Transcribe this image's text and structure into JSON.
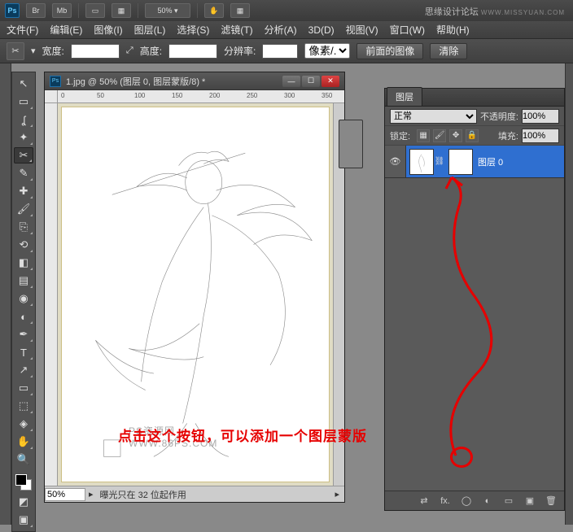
{
  "titlebar": {
    "zoom": "50% ▾"
  },
  "watermark_site": {
    "cn": "思缘设计论坛",
    "en": "WWW.MISSYUAN.COM"
  },
  "menu": {
    "file": "文件(F)",
    "edit": "编辑(E)",
    "image": "图像(I)",
    "layer": "图层(L)",
    "select": "选择(S)",
    "filter": "滤镜(T)",
    "analysis": "分析(A)",
    "three_d": "3D(D)",
    "view": "视图(V)",
    "window": "窗口(W)",
    "help": "帮助(H)"
  },
  "options": {
    "width_lbl": "宽度:",
    "height_lbl": "高度:",
    "resolution_lbl": "分辨率:",
    "unit": "像素/...",
    "front_image_btn": "前面的图像",
    "clear_btn": "清除"
  },
  "document": {
    "title": "1.jpg @ 50% (图层 0, 图层蒙版/8) *",
    "ruler_marks": [
      "0",
      "50",
      "100",
      "150",
      "200",
      "250",
      "300",
      "350"
    ],
    "zoom_field": "50%",
    "status_text": "曝光只在 32 位起作用"
  },
  "layers_panel": {
    "tab": "图层",
    "blend_mode": "正常",
    "opacity_lbl": "不透明度:",
    "opacity_val": "100%",
    "lock_lbl": "锁定:",
    "fill_lbl": "填充:",
    "fill_val": "100%",
    "layer0_name": "图层 0"
  },
  "annotation_text": "点击这个按钮，可以添加一个图层蒙版",
  "canvas_watermark": "PS资源网  WWW.86PS.COM",
  "icons": {
    "link": "⇄",
    "arrows": "⤢",
    "move": "↖",
    "marquee": "▭",
    "lasso": "ʆ",
    "wand": "✦",
    "crop": "✂",
    "eyedropper": "✎",
    "heal": "✚",
    "brush": "🖌",
    "stamp": "⎘",
    "history": "⟲",
    "eraser": "◧",
    "gradient": "▤",
    "blur": "◉",
    "dodge": "◐",
    "pen": "✒",
    "type": "T",
    "path": "↗",
    "shape": "▭",
    "hand": "✋",
    "zoom": "🔍",
    "eye": "👁",
    "fx": "fx.",
    "mask": "◯",
    "adjust": "◐",
    "folder": "▭",
    "new": "▣",
    "trash": "🗑",
    "chain": "⛓"
  }
}
